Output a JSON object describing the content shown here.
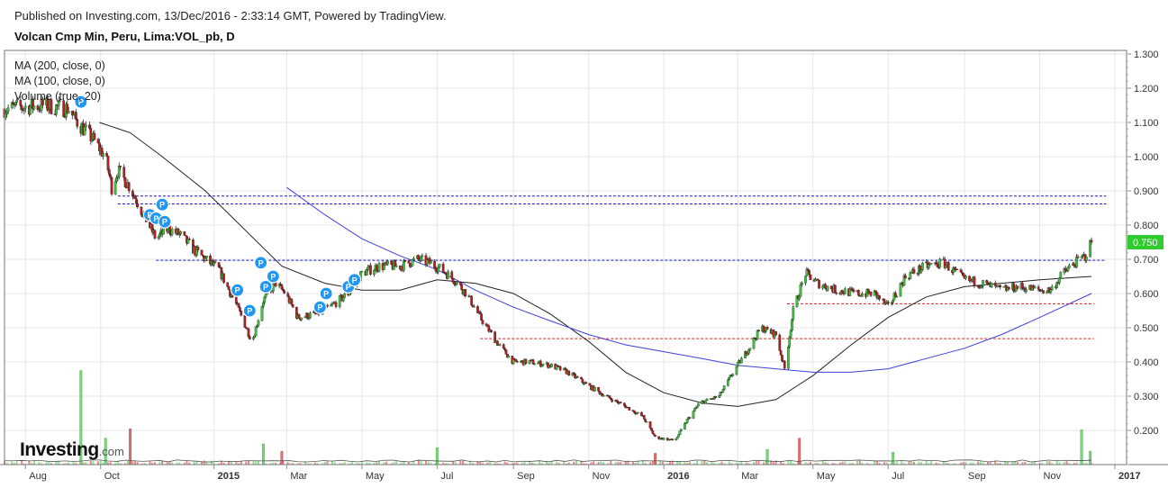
{
  "header": {
    "published": "Published on Investing.com, 13/Dec/2016 - 2:33:14 GMT, Powered by TradingView.",
    "symbol": "Volcan Cmp Min, Peru, Lima:VOL_pb, D"
  },
  "legend": [
    "MA (200, close, 0)",
    "MA (100, close, 0)",
    "Volume (true, 20)"
  ],
  "logo": {
    "main": "Investing",
    "suffix": ".com"
  },
  "colors": {
    "up": "#3fbf3f",
    "down": "#b41e1e",
    "ma200": "#3f3fd9",
    "ma100": "#222222",
    "hline_blue": "#1a1acc",
    "hline_red": "#d92020",
    "last_badge": "#2ecc2e",
    "marker": "#2196f3",
    "vol_up": "#7fd87f",
    "vol_down": "#e37373",
    "grid": "#e6e6e6"
  },
  "chart_data": {
    "type": "candlestick",
    "title": "Volcan Cmp Min, Peru, Lima:VOL_pb, D",
    "y_range": [
      0.1,
      1.3
    ],
    "y_ticks": [
      "1.300",
      "1.200",
      "1.100",
      "1.000",
      "0.900",
      "0.800",
      "0.700",
      "0.600",
      "0.500",
      "0.400",
      "0.300",
      "0.200"
    ],
    "x_ticks": [
      "Aug",
      "Oct",
      "2015",
      "Mar",
      "May",
      "Jul",
      "Sep",
      "Nov",
      "2016",
      "Mar",
      "May",
      "Jul",
      "Sep",
      "Nov",
      "2017"
    ],
    "last_price_label": "0.750",
    "price_path": [
      [
        "2014-07-15",
        1.14
      ],
      [
        "2014-08-15",
        1.15
      ],
      [
        "2014-09-05",
        1.14
      ],
      [
        "2014-09-10",
        1.11
      ],
      [
        "2014-09-25",
        1.05
      ],
      [
        "2014-10-05",
        1.0
      ],
      [
        "2014-10-10",
        0.91
      ],
      [
        "2014-10-15",
        0.96
      ],
      [
        "2014-10-25",
        0.91
      ],
      [
        "2014-11-05",
        0.83
      ],
      [
        "2014-11-15",
        0.76
      ],
      [
        "2014-11-25",
        0.79
      ],
      [
        "2014-12-05",
        0.77
      ],
      [
        "2014-12-15",
        0.73
      ],
      [
        "2014-12-25",
        0.7
      ],
      [
        "2015-01-05",
        0.67
      ],
      [
        "2015-01-20",
        0.56
      ],
      [
        "2015-02-01",
        0.46
      ],
      [
        "2015-02-10",
        0.58
      ],
      [
        "2015-02-20",
        0.63
      ],
      [
        "2015-02-28",
        0.6
      ],
      [
        "2015-03-10",
        0.53
      ],
      [
        "2015-03-25",
        0.54
      ],
      [
        "2015-04-05",
        0.56
      ],
      [
        "2015-04-20",
        0.6
      ],
      [
        "2015-05-01",
        0.66
      ],
      [
        "2015-05-15",
        0.68
      ],
      [
        "2015-06-01",
        0.68
      ],
      [
        "2015-06-15",
        0.7
      ],
      [
        "2015-06-25",
        0.69
      ],
      [
        "2015-07-05",
        0.67
      ],
      [
        "2015-07-15",
        0.64
      ],
      [
        "2015-07-25",
        0.6
      ],
      [
        "2015-08-05",
        0.53
      ],
      [
        "2015-08-20",
        0.45
      ],
      [
        "2015-09-01",
        0.4
      ],
      [
        "2015-09-15",
        0.4
      ],
      [
        "2015-10-01",
        0.39
      ],
      [
        "2015-10-15",
        0.37
      ],
      [
        "2015-11-01",
        0.33
      ],
      [
        "2015-11-15",
        0.3
      ],
      [
        "2015-12-01",
        0.27
      ],
      [
        "2015-12-15",
        0.24
      ],
      [
        "2015-12-25",
        0.18
      ],
      [
        "2016-01-10",
        0.17
      ],
      [
        "2016-01-20",
        0.23
      ],
      [
        "2016-01-30",
        0.28
      ],
      [
        "2016-02-15",
        0.3
      ],
      [
        "2016-02-28",
        0.38
      ],
      [
        "2016-03-10",
        0.44
      ],
      [
        "2016-03-20",
        0.5
      ],
      [
        "2016-04-01",
        0.48
      ],
      [
        "2016-04-08",
        0.38
      ],
      [
        "2016-04-15",
        0.55
      ],
      [
        "2016-04-25",
        0.66
      ],
      [
        "2016-05-05",
        0.63
      ],
      [
        "2016-05-20",
        0.61
      ],
      [
        "2016-06-05",
        0.6
      ],
      [
        "2016-06-20",
        0.6
      ],
      [
        "2016-07-01",
        0.56
      ],
      [
        "2016-07-15",
        0.65
      ],
      [
        "2016-08-01",
        0.68
      ],
      [
        "2016-08-15",
        0.69
      ],
      [
        "2016-09-01",
        0.64
      ],
      [
        "2016-09-15",
        0.63
      ],
      [
        "2016-10-01",
        0.61
      ],
      [
        "2016-10-15",
        0.62
      ],
      [
        "2016-11-01",
        0.61
      ],
      [
        "2016-11-10",
        0.61
      ],
      [
        "2016-11-20",
        0.66
      ],
      [
        "2016-11-30",
        0.69
      ],
      [
        "2016-12-08",
        0.71
      ],
      [
        "2016-12-13",
        0.75
      ]
    ],
    "ma100": [
      [
        "2014-09-30",
        1.1
      ],
      [
        "2014-10-25",
        1.07
      ],
      [
        "2014-11-20",
        1.0
      ],
      [
        "2014-12-25",
        0.9
      ],
      [
        "2015-01-25",
        0.79
      ],
      [
        "2015-02-25",
        0.68
      ],
      [
        "2015-04-01",
        0.63
      ],
      [
        "2015-05-01",
        0.61
      ],
      [
        "2015-06-01",
        0.61
      ],
      [
        "2015-07-01",
        0.64
      ],
      [
        "2015-08-01",
        0.63
      ],
      [
        "2015-09-01",
        0.6
      ],
      [
        "2015-10-01",
        0.54
      ],
      [
        "2015-11-01",
        0.46
      ],
      [
        "2015-12-01",
        0.37
      ],
      [
        "2016-01-01",
        0.31
      ],
      [
        "2016-02-01",
        0.28
      ],
      [
        "2016-03-01",
        0.27
      ],
      [
        "2016-04-01",
        0.29
      ],
      [
        "2016-05-01",
        0.36
      ],
      [
        "2016-06-01",
        0.45
      ],
      [
        "2016-07-01",
        0.53
      ],
      [
        "2016-08-01",
        0.59
      ],
      [
        "2016-09-01",
        0.62
      ],
      [
        "2016-10-01",
        0.63
      ],
      [
        "2016-11-01",
        0.64
      ],
      [
        "2016-12-13",
        0.65
      ]
    ],
    "ma200": [
      [
        "2015-03-01",
        0.91
      ],
      [
        "2015-04-01",
        0.83
      ],
      [
        "2015-05-01",
        0.76
      ],
      [
        "2015-06-01",
        0.71
      ],
      [
        "2015-07-01",
        0.67
      ],
      [
        "2015-08-01",
        0.61
      ],
      [
        "2015-09-01",
        0.56
      ],
      [
        "2015-10-01",
        0.52
      ],
      [
        "2015-11-01",
        0.48
      ],
      [
        "2015-12-01",
        0.45
      ],
      [
        "2016-01-01",
        0.43
      ],
      [
        "2016-02-01",
        0.41
      ],
      [
        "2016-03-01",
        0.39
      ],
      [
        "2016-04-01",
        0.38
      ],
      [
        "2016-05-01",
        0.37
      ],
      [
        "2016-06-01",
        0.37
      ],
      [
        "2016-07-01",
        0.38
      ],
      [
        "2016-08-01",
        0.41
      ],
      [
        "2016-09-01",
        0.44
      ],
      [
        "2016-10-01",
        0.48
      ],
      [
        "2016-11-01",
        0.53
      ],
      [
        "2016-12-13",
        0.6
      ]
    ],
    "horizontal_lines": [
      {
        "value": 0.885,
        "style": "dashed",
        "color": "blue",
        "from": "2014-10-15",
        "to": "2016-12-25"
      },
      {
        "value": 0.862,
        "style": "dashed",
        "color": "blue",
        "from": "2014-10-15",
        "to": "2016-12-25"
      },
      {
        "value": 0.697,
        "style": "dashed",
        "color": "blue",
        "from": "2014-11-15",
        "to": "2016-12-25"
      },
      {
        "value": 0.57,
        "style": "dashed",
        "color": "red",
        "from": "2016-04-10",
        "to": "2016-12-15"
      },
      {
        "value": 0.468,
        "style": "dashed",
        "color": "red",
        "from": "2015-08-05",
        "to": "2016-12-15"
      }
    ],
    "dividend_markers": [
      {
        "date": "2014-09-15",
        "price": 1.16
      },
      {
        "date": "2014-11-10",
        "price": 0.83
      },
      {
        "date": "2014-11-15",
        "price": 0.82
      },
      {
        "date": "2014-11-20",
        "price": 0.86
      },
      {
        "date": "2014-11-22",
        "price": 0.81
      },
      {
        "date": "2015-01-20",
        "price": 0.61
      },
      {
        "date": "2015-01-30",
        "price": 0.55
      },
      {
        "date": "2015-02-08",
        "price": 0.69
      },
      {
        "date": "2015-02-12",
        "price": 0.62
      },
      {
        "date": "2015-02-18",
        "price": 0.65
      },
      {
        "date": "2015-03-28",
        "price": 0.56
      },
      {
        "date": "2015-04-02",
        "price": 0.6
      },
      {
        "date": "2015-04-20",
        "price": 0.62
      },
      {
        "date": "2015-04-25",
        "price": 0.64
      }
    ],
    "volume_spikes": [
      {
        "date": "2014-09-15",
        "value": 1.0,
        "up": true
      },
      {
        "date": "2014-10-05",
        "value": 0.28,
        "up": true
      },
      {
        "date": "2014-10-25",
        "value": 0.38,
        "up": false
      },
      {
        "date": "2015-02-10",
        "value": 0.22,
        "up": true
      },
      {
        "date": "2015-02-25",
        "value": 0.14,
        "up": false
      },
      {
        "date": "2015-07-01",
        "value": 0.18,
        "up": true
      },
      {
        "date": "2015-12-25",
        "value": 0.12,
        "up": false
      },
      {
        "date": "2016-03-25",
        "value": 0.16,
        "up": true
      },
      {
        "date": "2016-04-20",
        "value": 0.28,
        "up": false
      },
      {
        "date": "2016-07-05",
        "value": 0.13,
        "up": true
      },
      {
        "date": "2016-12-05",
        "value": 0.37,
        "up": true
      },
      {
        "date": "2016-12-12",
        "value": 0.14,
        "up": true
      }
    ],
    "grid": true
  }
}
